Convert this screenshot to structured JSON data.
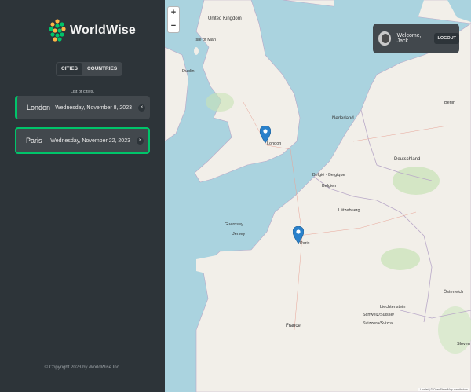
{
  "sidebar": {
    "app_name": "WorldWise",
    "tabs": [
      {
        "label": "Cities",
        "active": true
      },
      {
        "label": "Countries",
        "active": false
      }
    ],
    "list_caption": "List of cities.",
    "cities": [
      {
        "name": "London",
        "date": "Wednesday, November 8, 2023",
        "delete": "×"
      },
      {
        "name": "Paris",
        "date": "Wednesday, November 22, 2023",
        "delete": "×"
      }
    ],
    "copyright": "© Copyright 2023 by WorldWise Inc."
  },
  "map": {
    "zoom_in": "+",
    "zoom_out": "−",
    "labels": {
      "united_kingdom": "United Kingdom",
      "isle_of_man": "Isle of Man",
      "dublin": "Dublin",
      "london": "London",
      "nederland": "Nederland",
      "deutschland": "Deutschland",
      "belgie": "België - Belgique",
      "belgien": "Belgien",
      "letzebuerg": "Lëtzebuerg",
      "guernsey": "Guernsey",
      "jersey": "Jersey",
      "paris": "Paris",
      "france": "France",
      "osterreich": "Österreich",
      "liechtenstein": "Liechtenstein",
      "schweiz": "Schweiz/Suisse/",
      "svizzera": "Svizzera/Svizra",
      "sloven": "Sloven",
      "berlin": "Berlin"
    },
    "attribution": "Leaflet | © OpenStreetMap contributors"
  },
  "user": {
    "welcome": "Welcome, Jack",
    "logout": "Logout"
  },
  "colors": {
    "sidebar_bg": "#2d3439",
    "panel_bg": "#42484d",
    "accent_green": "#00c46a",
    "sea": "#aad3df",
    "land": "#f2efe9",
    "marker": "#2a81cb"
  }
}
